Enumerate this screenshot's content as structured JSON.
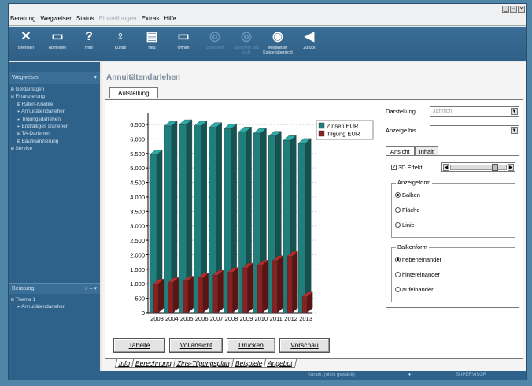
{
  "window": {
    "min": "_",
    "restore": "▫",
    "close": "×"
  },
  "menu": [
    {
      "label": "Beratung",
      "enabled": true
    },
    {
      "label": "Wegweiser",
      "enabled": true
    },
    {
      "label": "Status",
      "enabled": true
    },
    {
      "label": "Einstellungen",
      "enabled": false
    },
    {
      "label": "Extras",
      "enabled": true
    },
    {
      "label": "Hilfe",
      "enabled": true
    }
  ],
  "toolbar": [
    {
      "label": "Beenden",
      "icon": "close-icon",
      "glyph": "✕",
      "enabled": true
    },
    {
      "label": "Abmelden",
      "icon": "logout-icon",
      "glyph": "▭",
      "enabled": true
    },
    {
      "label": "Hilfe",
      "icon": "help-icon",
      "glyph": "?",
      "enabled": true
    },
    {
      "label": "Kunde",
      "icon": "customer-icon",
      "glyph": "♀",
      "enabled": true
    },
    {
      "label": "Neu",
      "icon": "new-document-icon",
      "glyph": "▤",
      "enabled": true
    },
    {
      "label": "Öffnen",
      "icon": "open-folder-icon",
      "glyph": "▭",
      "enabled": true
    },
    {
      "label": "Speichern",
      "icon": "save-icon",
      "glyph": "◎",
      "enabled": false
    },
    {
      "label": "Speichern und Ende",
      "icon": "save-exit-icon",
      "glyph": "◎",
      "enabled": false
    },
    {
      "label": "Wegweiser Kundenübersicht",
      "icon": "eye-icon",
      "glyph": "◉",
      "enabled": true
    },
    {
      "label": "Zurück",
      "icon": "back-icon",
      "glyph": "◀",
      "enabled": true
    }
  ],
  "wegweiser": {
    "title": "Wegweiser",
    "controls": "▾",
    "tree": [
      {
        "label": "Geldanlagen",
        "level": 0,
        "expander": "⊞"
      },
      {
        "label": "Finanzierung",
        "level": 0,
        "expander": "⊟"
      },
      {
        "label": "Raten-Kredite",
        "level": 1,
        "expander": "⊞"
      },
      {
        "label": "Annuitätendarlehen",
        "level": 1,
        "expander": "▸"
      },
      {
        "label": "Tilgungsdarlehen",
        "level": 1,
        "expander": "▸"
      },
      {
        "label": "Endfälliges Darlehen",
        "level": 1,
        "expander": "▸"
      },
      {
        "label": "TA-Darlehen",
        "level": 1,
        "expander": "⊞"
      },
      {
        "label": "Baufinanzierung",
        "level": 1,
        "expander": "⊞"
      },
      {
        "label": "Service",
        "level": 0,
        "expander": "⊞"
      }
    ]
  },
  "beratung": {
    "title": "Beratung",
    "controls": "○ – ▾",
    "tree": [
      {
        "label": "Thema 1",
        "level": 0,
        "expander": "⊟"
      },
      {
        "label": "Annuitätendarlehen",
        "level": 1,
        "expander": "▸"
      }
    ]
  },
  "page": {
    "title": "Annuitätendarlehen",
    "tab": "Aufstellung"
  },
  "options": {
    "darstellung_label": "Darstellung",
    "darstellung_value": "Jährlich",
    "anzeige_bis_label": "Anzeige bis",
    "anzeige_bis_value": "",
    "subtabs": [
      "Ansicht",
      "Inhalt"
    ],
    "effekt_3d_label": "3D Effekt",
    "effekt_3d_checked": true,
    "effekt_3d_check_glyph": "✓",
    "slider_level": 0.8,
    "anzeigeform_title": "Anzeigeform",
    "anzeigeform": [
      {
        "label": "Balken",
        "selected": true
      },
      {
        "label": "Fläche",
        "selected": false
      },
      {
        "label": "Linie",
        "selected": false
      }
    ],
    "balkenform_title": "Balkenform",
    "balkenform": [
      {
        "label": "nebeneinander",
        "selected": true
      },
      {
        "label": "hintereinander",
        "selected": false
      },
      {
        "label": "aufeinander",
        "selected": false
      }
    ]
  },
  "buttons": {
    "tabelle": "Tabelle",
    "vollansicht": "Vollansicht",
    "drucken": "Drucken",
    "vorschau": "Vorschau"
  },
  "bottom_tabs": [
    "Info",
    "Berechnung",
    "Zins-Tilgungsplan",
    "Beispiele",
    "Angebot"
  ],
  "bottom_tab_active": 2,
  "status": {
    "kunde": "Kunde: (nicht gewählt)",
    "arrow": "♦",
    "user": "SUPERVISOR"
  },
  "colors": {
    "zinsen": "#1f7f7c",
    "tilgung": "#8c1f1f"
  },
  "chart_data": {
    "type": "bar",
    "categories": [
      "2003",
      "2004",
      "2005",
      "2006",
      "2007",
      "2008",
      "2009",
      "2010",
      "2011",
      "2012",
      "2013"
    ],
    "series": [
      {
        "name": "Zinsen EUR",
        "values": [
          5450,
          6450,
          6500,
          6450,
          6400,
          6350,
          6250,
          6200,
          6100,
          5950,
          5850
        ]
      },
      {
        "name": "Tilgung EUR",
        "values": [
          1000,
          1050,
          1100,
          1200,
          1300,
          1400,
          1550,
          1650,
          1800,
          1950,
          550
        ]
      }
    ],
    "ylim": [
      0,
      6800
    ],
    "yticks": [
      "0",
      "500",
      "1.000",
      "1.500",
      "2.000",
      "2.500",
      "3.000",
      "3.500",
      "4.000",
      "4.500",
      "5.000",
      "5.500",
      "6.000",
      "6.500"
    ],
    "grid": true,
    "legend": "top-right",
    "three_d": true
  }
}
